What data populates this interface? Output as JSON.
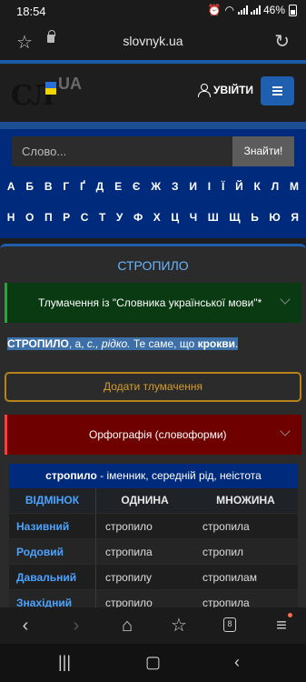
{
  "status": {
    "time": "18:54",
    "battery": "46%"
  },
  "browser": {
    "url": "slovnyk.ua",
    "tab_count": "8"
  },
  "header": {
    "logo_text": "СЛ",
    "logo_ua": "UA",
    "login_label": "УВІЙТИ"
  },
  "search": {
    "placeholder": "Слово...",
    "button_label": "Знайти!"
  },
  "alphabet": {
    "row1": [
      "А",
      "Б",
      "В",
      "Г",
      "Ґ",
      "Д",
      "Е",
      "Є",
      "Ж",
      "З",
      "И",
      "І",
      "Ї",
      "Й",
      "К",
      "Л",
      "М"
    ],
    "row2": [
      "Н",
      "О",
      "П",
      "Р",
      "С",
      "Т",
      "У",
      "Ф",
      "Х",
      "Ц",
      "Ч",
      "Ш",
      "Щ",
      "Ь",
      "Ю",
      "Я"
    ]
  },
  "entry": {
    "word": "СТРОПИЛО",
    "dictionary_title": "Тлумачення із \"Словника української мови\"*",
    "definition": {
      "headword": "СТРОПИЛО",
      "grammar": ", а, ",
      "abbr": "с., рідко.",
      "text": " Те саме, що ",
      "link": "крокви",
      "end": "."
    },
    "add_button": "Додати тлумачення",
    "orthography_title": "Орфографія (словоформи)"
  },
  "table": {
    "headword": "стропило",
    "description": " - іменник, середній рід, неістота",
    "columns": [
      "ВІДМІНОК",
      "ОДНИНА",
      "МНОЖИНА"
    ],
    "rows": [
      {
        "case": "Називний",
        "singular": "стропило",
        "plural": "стропила"
      },
      {
        "case": "Родовий",
        "singular": "стропила",
        "plural": "стропил"
      },
      {
        "case": "Давальний",
        "singular": "стропилу",
        "plural": "стропилам"
      },
      {
        "case": "Знахідний",
        "singular": "стропило",
        "plural": "стропила"
      }
    ]
  }
}
